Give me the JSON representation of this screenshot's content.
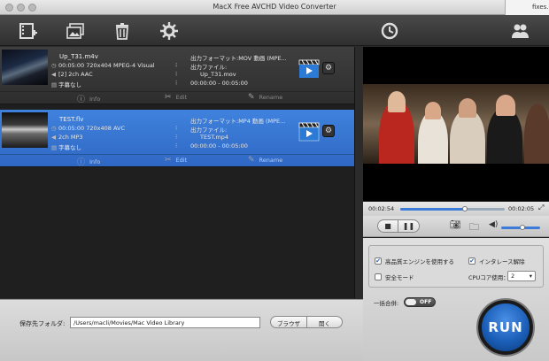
{
  "window": {
    "title": "MacX Free AVCHD Video Converter",
    "side_tab": "fixes."
  },
  "toolbar": {
    "buttons": [
      {
        "name": "add-video-icon"
      },
      {
        "name": "add-photo-icon"
      },
      {
        "name": "trash-icon"
      },
      {
        "name": "gear-icon"
      },
      {
        "name": "refresh-icon"
      },
      {
        "name": "users-icon"
      }
    ]
  },
  "files": [
    {
      "name": "Up_T31.m4v",
      "duration_res": "00:05:00 720x404 MPEG-4 Visual",
      "audio": "[2] 2ch AAC",
      "subtitle": "字幕なし",
      "out_format": "出力フォーマット:MOV 動画 (MPE...",
      "out_file_label": "出力ファイル:",
      "out_file": "Up_T31.mov",
      "range": "00:00:00 - 00:05:00",
      "selected": false
    },
    {
      "name": "TEST.flv",
      "duration_res": "00:05:00 720x408 AVC",
      "audio": "2ch MP3",
      "subtitle": "字幕なし",
      "out_format": "出力フォーマット:MP4 動画 (MPE...",
      "out_file_label": "出力ファイル:",
      "out_file": "TEST.mp4",
      "range": "00:00:00 - 00:05:00",
      "selected": true
    }
  ],
  "row_actions": {
    "info": "Info",
    "edit": "Edit",
    "rename": "Rename"
  },
  "destination": {
    "label": "保存先フォルダ:",
    "path": "/Users/macli/Movies/Mac Video Library",
    "browse": "ブラウザ",
    "open": "開く"
  },
  "player": {
    "current_time": "00:02:54",
    "total_time": "00:02:05",
    "progress": 0.62,
    "volume": 0.55
  },
  "options": {
    "hq_engine": {
      "label": "高品質エンジンを使用する",
      "checked": true
    },
    "deinterlace": {
      "label": "インタレース解除",
      "checked": true
    },
    "safe_mode": {
      "label": "安全モード",
      "checked": false
    },
    "cpu_label": "CPUコア使用：",
    "cpu_value": "2",
    "merge_label": "一括合併:",
    "merge_toggle": "OFF",
    "run_label": "RUN"
  },
  "colors": {
    "selected_row": "#3f82dd",
    "accent": "#3d7bd8",
    "run": "#1b5fb8"
  }
}
